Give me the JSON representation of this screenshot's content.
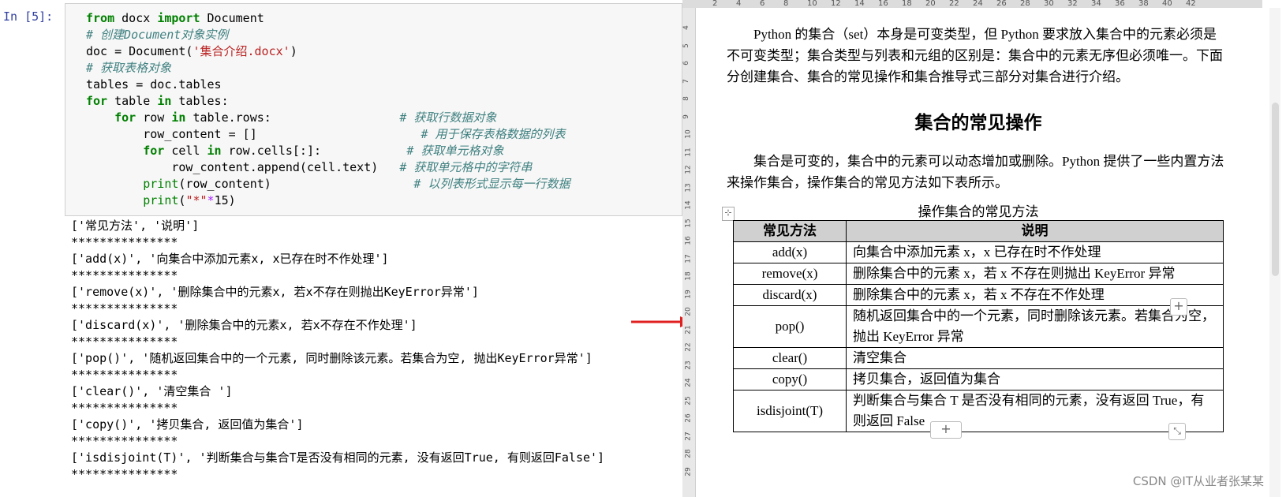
{
  "notebook": {
    "prompt": "In  [5]:",
    "code": [
      [
        {
          "t": "from",
          "c": "kw"
        },
        {
          "t": " docx "
        },
        {
          "t": "import",
          "c": "kw"
        },
        {
          "t": " Document"
        }
      ],
      [
        {
          "t": "# 创建Document对象实例",
          "c": "cm"
        }
      ],
      [
        {
          "t": "doc = Document("
        },
        {
          "t": "'集合介绍.docx'",
          "c": "st"
        },
        {
          "t": ")"
        }
      ],
      [
        {
          "t": "# 获取表格对象",
          "c": "cm"
        }
      ],
      [
        {
          "t": "tables = doc.tables"
        }
      ],
      [
        {
          "t": "for",
          "c": "kw"
        },
        {
          "t": " table "
        },
        {
          "t": "in",
          "c": "kw"
        },
        {
          "t": " tables:"
        }
      ],
      [
        {
          "t": "    "
        },
        {
          "t": "for",
          "c": "kw"
        },
        {
          "t": " row "
        },
        {
          "t": "in",
          "c": "kw"
        },
        {
          "t": " table.rows:                  "
        },
        {
          "t": "# 获取行数据对象",
          "c": "cm"
        }
      ],
      [
        {
          "t": "        row_content = []                       "
        },
        {
          "t": "# 用于保存表格数据的列表",
          "c": "cm"
        }
      ],
      [
        {
          "t": "        "
        },
        {
          "t": "for",
          "c": "kw"
        },
        {
          "t": " cell "
        },
        {
          "t": "in",
          "c": "kw"
        },
        {
          "t": " row.cells[:]:            "
        },
        {
          "t": "# 获取单元格对象",
          "c": "cm"
        }
      ],
      [
        {
          "t": "            row_content.append(cell.text)   "
        },
        {
          "t": "# 获取单元格中的字符串",
          "c": "cm"
        }
      ],
      [
        {
          "t": "        "
        },
        {
          "t": "print",
          "c": "bi"
        },
        {
          "t": "(row_content)                    "
        },
        {
          "t": "# 以列表形式显示每一行数据",
          "c": "cm"
        }
      ],
      [
        {
          "t": "        "
        },
        {
          "t": "print",
          "c": "bi"
        },
        {
          "t": "("
        },
        {
          "t": "\"*\"",
          "c": "st"
        },
        {
          "t": "*",
          "c": "op"
        },
        {
          "t": "15)"
        }
      ]
    ],
    "output": [
      "['常见方法', '说明']",
      "***************",
      "['add(x)', '向集合中添加元素x, x已存在时不作处理']",
      "***************",
      "['remove(x)', '删除集合中的元素x, 若x不存在则抛出KeyError异常']",
      "***************",
      "['discard(x)', '删除集合中的元素x, 若x不存在不作处理']",
      "***************",
      "['pop()', '随机返回集合中的一个元素, 同时删除该元素。若集合为空, 抛出KeyError异常']",
      "***************",
      "['clear()', '清空集合 ']",
      "***************",
      "['copy()', '拷贝集合, 返回值为集合']",
      "***************",
      "['isdisjoint(T)', '判断集合与集合T是否没有相同的元素, 没有返回True, 有则返回False']",
      "***************"
    ]
  },
  "document": {
    "ruler_ticks": [
      "2",
      "4",
      "6",
      "8",
      "10",
      "12",
      "14",
      "16",
      "18",
      "20",
      "22",
      "24",
      "26",
      "28",
      "30",
      "32",
      "34",
      "36",
      "38",
      "40",
      "42"
    ],
    "vruler_ticks": [
      "4",
      "5",
      "6",
      "7",
      "8",
      "9",
      "10",
      "11",
      "12",
      "13",
      "14",
      "15",
      "16",
      "17",
      "18",
      "19",
      "20",
      "21",
      "22",
      "23",
      "24",
      "25",
      "26",
      "27",
      "28",
      "29"
    ],
    "intro": "Python 的集合（set）本身是可变类型，但 Python 要求放入集合中的元素必须是不可变类型；集合类型与列表和元组的区别是：集合中的元素无序但必须唯一。下面分创建集合、集合的常见操作和集合推导式三部分对集合进行介绍。",
    "heading": "集合的常见操作",
    "para2": "集合是可变的，集合中的元素可以动态增加或删除。Python 提供了一些内置方法来操作集合，操作集合的常见方法如下表所示。",
    "caption": "操作集合的常见方法",
    "table": {
      "headers": [
        "常见方法",
        "说明"
      ],
      "rows": [
        {
          "method": "add(x)",
          "desc": "向集合中添加元素 x，x 已存在时不作处理"
        },
        {
          "method": "remove(x)",
          "desc": "删除集合中的元素 x，若 x 不存在则抛出 KeyError 异常"
        },
        {
          "method": "discard(x)",
          "desc": "删除集合中的元素 x，若 x 不存在不作处理"
        },
        {
          "method": "pop()",
          "desc": "随机返回集合中的一个元素，同时删除该元素。若集合为空，抛出 KeyError 异常"
        },
        {
          "method": "clear()",
          "desc": "清空集合"
        },
        {
          "method": "copy()",
          "desc": "拷贝集合，返回值为集合"
        },
        {
          "method": "isdisjoint(T)",
          "desc": "判断集合与集合 T 是否没有相同的元素，没有返回 True，有则返回 False"
        }
      ]
    },
    "add_row_symbol": "+",
    "add_col_symbol": "+",
    "expand_icon": "expand-icon",
    "watermark": "CSDN @IT从业者张某某"
  },
  "colors": {
    "keyword": "#008000",
    "comment": "#408080",
    "string": "#ba2121",
    "prompt": "#303f9f",
    "arrow": "#e02020",
    "table_header_bg": "#d0d0d0"
  }
}
